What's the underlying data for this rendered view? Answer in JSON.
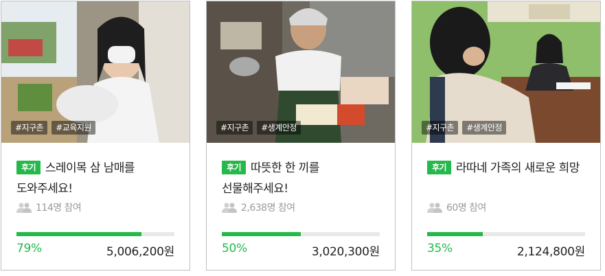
{
  "cards": [
    {
      "tags": [
        "#지구촌",
        "#교육지원"
      ],
      "badge": "후기",
      "title": "스레이목 삼 남매를 도와주세요!",
      "participants": "114명 참여",
      "progress": 0.79,
      "percent": "79%",
      "amount": "5,006,200원",
      "photo_desc": "girl-holding-rice-bag"
    },
    {
      "tags": [
        "#지구촌",
        "#생계안정"
      ],
      "badge": "후기",
      "title": "따뜻한 한 끼를 선물해주세요!",
      "participants": "2,638명 참여",
      "progress": 0.5,
      "percent": "50%",
      "amount": "3,020,300원",
      "photo_desc": "elderly-woman-with-food"
    },
    {
      "tags": [
        "#지구촌",
        "#생계안정"
      ],
      "badge": "후기",
      "title": "라따네 가족의 새로운 희망",
      "participants": "60명 참여",
      "progress": 0.35,
      "percent": "35%",
      "amount": "2,124,800원",
      "photo_desc": "girl-at-desk-interview"
    }
  ],
  "colors": {
    "accent": "#25b84a",
    "track": "#e9e9e9",
    "muted": "#9a9a9a"
  },
  "icons": {
    "participants": "people-icon"
  }
}
